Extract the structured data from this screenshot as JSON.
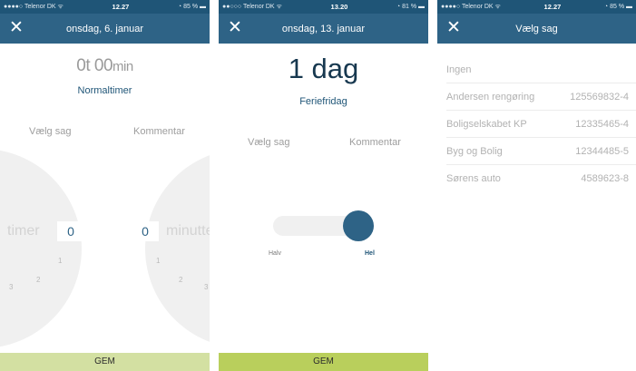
{
  "screens": [
    {
      "status": {
        "carrier": "●●●●○ Telenor DK ᯤ",
        "time": "12.27",
        "battery": "◔ 85 % ▬"
      },
      "nav": {
        "close_icon": "close-icon",
        "title": "onsdag, 6. januar"
      },
      "time": {
        "hours": "0t",
        "minutes": "00",
        "unit": "min"
      },
      "type_label": "Normaltimer",
      "actions": {
        "choose_case": "Vælg sag",
        "comment": "Kommentar"
      },
      "hours_dial": {
        "label": "timer",
        "value": "0",
        "ticks": [
          "1",
          "2",
          "3"
        ]
      },
      "minutes_dial": {
        "label": "minutter",
        "value": "0",
        "ticks": [
          "1",
          "2",
          "3"
        ]
      },
      "save_label": "GEM"
    },
    {
      "status": {
        "carrier": "●●○○○ Telenor DK ᯤ",
        "time": "13.20",
        "battery": "◔ 81 % ▬"
      },
      "nav": {
        "close_icon": "close-icon",
        "title": "onsdag, 13. januar"
      },
      "days": "1 dag",
      "type_label": "Feriefridag",
      "actions": {
        "choose_case": "Vælg sag",
        "comment": "Kommentar"
      },
      "toggle": {
        "left_label": "Halv",
        "right_label": "Hel",
        "selected": "Hel"
      },
      "save_label": "GEM"
    },
    {
      "status": {
        "carrier": "●●●●○ Telenor DK ᯤ",
        "time": "12.27",
        "battery": "◔ 85 % ▬"
      },
      "nav": {
        "close_icon": "close-icon",
        "title": "Vælg sag"
      },
      "cases": [
        {
          "name": "Ingen",
          "number": ""
        },
        {
          "name": "Andersen rengøring",
          "number": "125569832-4"
        },
        {
          "name": "Boligselskabet KP",
          "number": "12335465-4"
        },
        {
          "name": "Byg og Bolig",
          "number": "12344485-5"
        },
        {
          "name": "Sørens auto",
          "number": "4589623-8"
        }
      ]
    }
  ],
  "colors": {
    "status_bar": "#1f5577",
    "nav_bar": "#2e6386",
    "accent": "#2e6386",
    "save_light": "#d3e0a2",
    "save_dark": "#b9cf5c",
    "dial": "#f0f0f0"
  }
}
